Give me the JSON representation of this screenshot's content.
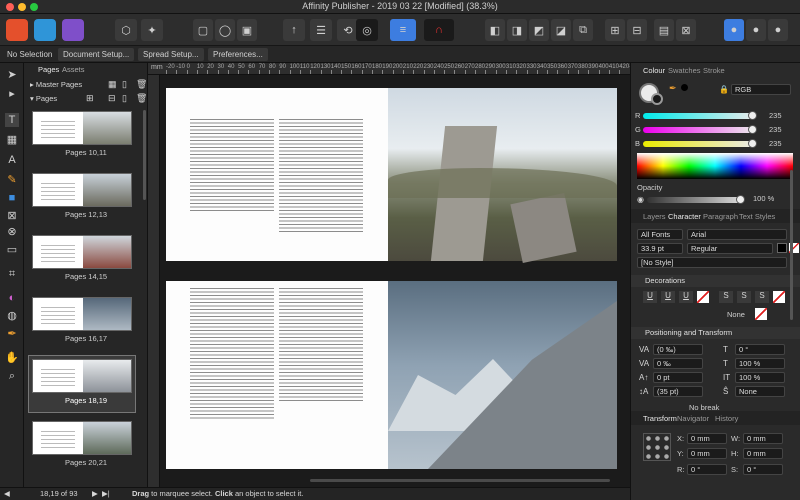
{
  "window": {
    "title": "Affinity Publisher - 2019 03 22 [Modified] (38.3%)"
  },
  "context_bar": {
    "selection": "No Selection",
    "document_setup": "Document Setup...",
    "spread_setup": "Spread Setup...",
    "preferences": "Preferences..."
  },
  "pages_panel": {
    "tab_pages": "Pages",
    "tab_assets": "Assets",
    "master_pages": "Master Pages",
    "pages": "Pages",
    "thumbs": [
      "Pages 10,11",
      "Pages 12,13",
      "Pages 14,15",
      "Pages 16,17",
      "Pages 18,19",
      "Pages 20,21"
    ]
  },
  "ruler": {
    "unit": "mm",
    "ticks": [
      "-20",
      "-10",
      "0",
      "10",
      "20",
      "30",
      "40",
      "50",
      "60",
      "70",
      "80",
      "90",
      "100",
      "110",
      "120",
      "130",
      "140",
      "150",
      "160",
      "170",
      "180",
      "190",
      "200",
      "210",
      "220",
      "230",
      "240",
      "250",
      "260",
      "270",
      "280",
      "290",
      "300",
      "310",
      "320",
      "330",
      "340",
      "350",
      "360",
      "370",
      "380",
      "390",
      "400",
      "410",
      "420",
      "430"
    ]
  },
  "status": {
    "page": "18,19 of 93",
    "hint_drag": "Drag",
    "hint_text1": " to marquee select. ",
    "hint_click": "Click",
    "hint_text2": " an object to select it."
  },
  "color_panel": {
    "tabs": [
      "Colour",
      "Swatches",
      "Stroke"
    ],
    "model": "RGB",
    "r_label": "R",
    "g_label": "G",
    "b_label": "B",
    "r": "235",
    "g": "235",
    "b": "235",
    "opacity_label": "Opacity",
    "opacity": "100 %"
  },
  "character_panel": {
    "tabs": [
      "Layers",
      "Character",
      "Paragraph",
      "Text Styles"
    ],
    "font_collection": "All Fonts",
    "font": "Arial",
    "size": "33.9 pt",
    "weight": "Regular",
    "style": "[No Style]",
    "decorations_label": "Decorations",
    "decoration_none": "None",
    "positioning_label": "Positioning and Transform",
    "fields": [
      "(0 ‰)",
      "0 ‰",
      "0 pt",
      "(35 pt)",
      "0 °",
      "100 %",
      "100 %",
      "None"
    ],
    "no_break": "No break"
  },
  "transform_panel": {
    "tabs": [
      "Transform",
      "Navigator",
      "History"
    ],
    "x_label": "X:",
    "y_label": "Y:",
    "w_label": "W:",
    "h_label": "H:",
    "r_label": "R:",
    "s_label": "S:",
    "x": "0 mm",
    "y": "0 mm",
    "w": "0 mm",
    "h": "0 mm",
    "r": "0 °",
    "s": "0 °"
  },
  "colors": {
    "accent": "#3d7de0",
    "persona_publisher": "#e4502c",
    "persona_designer": "#2f95d8",
    "persona_photo": "#7f4fc9"
  }
}
